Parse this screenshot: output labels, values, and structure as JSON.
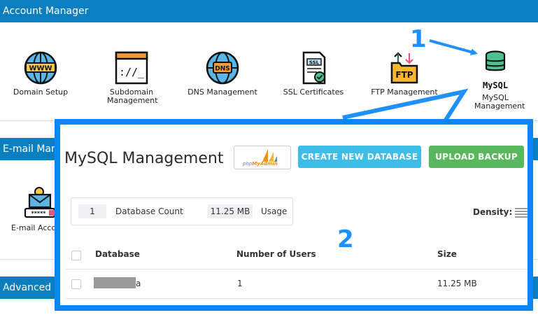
{
  "sections": {
    "account_manager": "Account Manager",
    "email_manager": "E-mail Man",
    "advanced": "Advanced F"
  },
  "tools": [
    {
      "label": "Domain Setup",
      "icon": "www-globe-icon"
    },
    {
      "label": "Subdomain Management",
      "icon": "terminal-window-icon"
    },
    {
      "label": "DNS Management",
      "icon": "dns-globe-icon"
    },
    {
      "label": "SSL Certificates",
      "icon": "ssl-certificate-icon"
    },
    {
      "label": "FTP Management",
      "icon": "ftp-transfer-icon"
    },
    {
      "label": "MySQL Management",
      "icon": "mysql-database-icon"
    }
  ],
  "email_tool": {
    "label": "E-mail Acco",
    "icon": "email-lock-icon"
  },
  "annotations": {
    "one": "1",
    "two": "2"
  },
  "panel": {
    "title": "MySQL Management",
    "pma_logo": {
      "php": "php",
      "myadmin": "MyAdmin"
    },
    "create_button": "CREATE NEW DATABASE",
    "upload_button": "UPLOAD BACKUP",
    "stats": {
      "db_count": "1",
      "db_count_label": "Database Count",
      "usage": "11.25 MB",
      "usage_label": "Usage"
    },
    "density_label": "Density:",
    "columns": [
      "Database",
      "Number of Users",
      "Size"
    ],
    "rows": [
      {
        "database": "a",
        "users": "1",
        "size": "11.25 MB"
      }
    ]
  },
  "colors": {
    "accent": "#0a7fbf",
    "annotation": "#1e90ff",
    "create": "#3fbde9",
    "upload": "#5ab85c"
  }
}
